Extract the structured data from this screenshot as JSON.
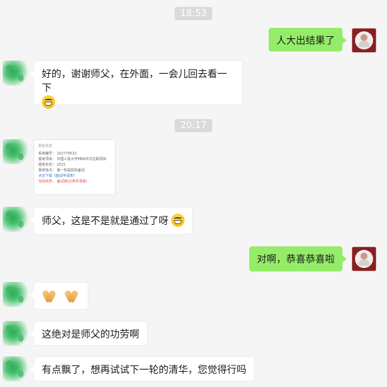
{
  "timestamps": [
    "18:53",
    "20:17"
  ],
  "messages": [
    {
      "side": "right",
      "text": "人大出结果了"
    },
    {
      "side": "left",
      "text": "好的，谢谢师父，在外面，一会儿回去看一下",
      "emoji": "grin-emoji"
    },
    {
      "side": "left",
      "type": "image",
      "lines": [
        "报名信息",
        "系统编号：  202779532",
        "报考项目：  中国人民大学MBA中文在职项目",
        "报考年份：  2021",
        "报考批次：  第一轮提前批面试",
        "点击下载《面试申请表》",
        "当前状态：  面试通过(条件录取)"
      ]
    },
    {
      "side": "left",
      "text": "师父，这是不是就是通过了呀",
      "emoji": "grin-emoji"
    },
    {
      "side": "right",
      "text": "对啊，恭喜恭喜啦"
    },
    {
      "side": "left",
      "type": "emoji-only",
      "emoji": "folded-hands-emoji",
      "count": 2
    },
    {
      "side": "left",
      "text": "这绝对是师父的功劳啊"
    },
    {
      "side": "left",
      "text": "有点飘了，想再试试下一轮的清华，您觉得行吗"
    }
  ],
  "colors": {
    "background": "#f5f5f5",
    "sent_bubble": "#95ec69",
    "received_bubble": "#ffffff",
    "timestamp_bg": "#dadada"
  }
}
